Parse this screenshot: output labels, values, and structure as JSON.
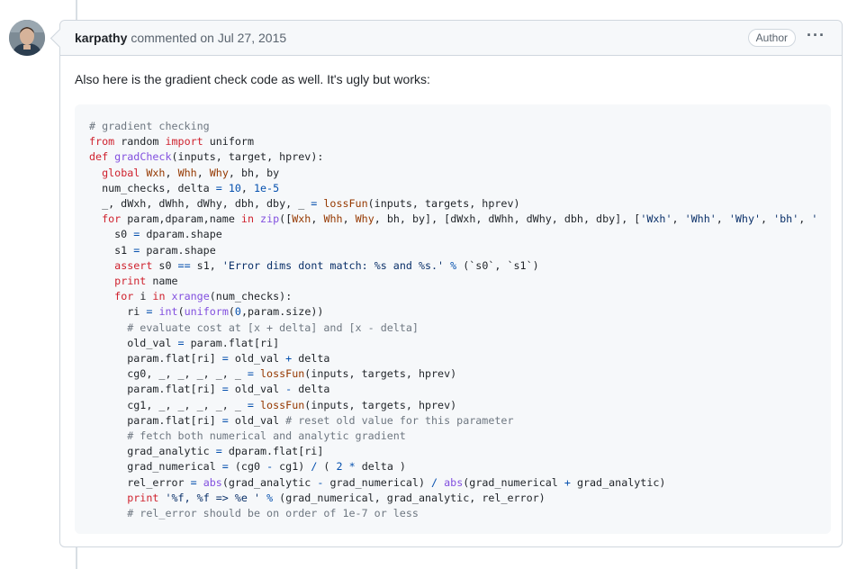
{
  "comment": {
    "author": "karpathy",
    "action": "commented on Jul 27, 2015",
    "badge": "Author",
    "menu_glyph": "···",
    "text": "Also here is the gradient check code as well. It's ugly but works:",
    "avatar_icon": "user-avatar"
  },
  "colors": {
    "keyword": "#cf222e",
    "function": "#8250df",
    "number": "#0550ae",
    "string": "#0a3069",
    "comment": "#6e7781",
    "variable": "#953800"
  },
  "code_lines": [
    [
      [
        "cm",
        "# gradient checking"
      ]
    ],
    [
      [
        "kw",
        "from"
      ],
      [
        "",
        " random "
      ],
      [
        "kw",
        "import"
      ],
      [
        "",
        " uniform"
      ]
    ],
    [
      [
        "kw",
        "def"
      ],
      [
        "",
        " "
      ],
      [
        "fn",
        "gradCheck"
      ],
      [
        "",
        "(inputs, target, hprev):"
      ]
    ],
    [
      [
        "",
        "  "
      ],
      [
        "kw",
        "global"
      ],
      [
        "",
        " "
      ],
      [
        "var",
        "Wxh"
      ],
      [
        "",
        ", "
      ],
      [
        "var",
        "Whh"
      ],
      [
        "",
        ", "
      ],
      [
        "var",
        "Why"
      ],
      [
        "",
        ", bh, by"
      ]
    ],
    [
      [
        "",
        "  num_checks, delta "
      ],
      [
        "op",
        "="
      ],
      [
        "",
        " "
      ],
      [
        "num",
        "10"
      ],
      [
        "",
        ", "
      ],
      [
        "num",
        "1e-5"
      ]
    ],
    [
      [
        "",
        "  _, dWxh, dWhh, dWhy, dbh, dby, _ "
      ],
      [
        "op",
        "="
      ],
      [
        "",
        " "
      ],
      [
        "var",
        "lossFun"
      ],
      [
        "",
        "(inputs, targets, hprev)"
      ]
    ],
    [
      [
        "",
        "  "
      ],
      [
        "kw",
        "for"
      ],
      [
        "",
        " param,dparam,name "
      ],
      [
        "kw",
        "in"
      ],
      [
        "",
        " "
      ],
      [
        "fn",
        "zip"
      ],
      [
        "",
        "(["
      ],
      [
        "var",
        "Wxh"
      ],
      [
        "",
        ", "
      ],
      [
        "var",
        "Whh"
      ],
      [
        "",
        ", "
      ],
      [
        "var",
        "Why"
      ],
      [
        "",
        ", bh, by], [dWxh, dWhh, dWhy, dbh, dby], ["
      ],
      [
        "str",
        "'Wxh'"
      ],
      [
        "",
        ", "
      ],
      [
        "str",
        "'Whh'"
      ],
      [
        "",
        ", "
      ],
      [
        "str",
        "'Why'"
      ],
      [
        "",
        ", "
      ],
      [
        "str",
        "'bh'"
      ],
      [
        "",
        ", "
      ],
      [
        "str",
        "'by'"
      ],
      [
        "",
        "]):"
      ]
    ],
    [
      [
        "",
        "    s0 "
      ],
      [
        "op",
        "="
      ],
      [
        "",
        " dparam.shape"
      ]
    ],
    [
      [
        "",
        "    s1 "
      ],
      [
        "op",
        "="
      ],
      [
        "",
        " param.shape"
      ]
    ],
    [
      [
        "",
        "    "
      ],
      [
        "kw",
        "assert"
      ],
      [
        "",
        " s0 "
      ],
      [
        "op",
        "=="
      ],
      [
        "",
        " s1, "
      ],
      [
        "str",
        "'Error dims dont match: %s and %s.'"
      ],
      [
        "",
        " "
      ],
      [
        "op",
        "%"
      ],
      [
        "",
        " (`s0`, `s1`)"
      ]
    ],
    [
      [
        "",
        "    "
      ],
      [
        "kw",
        "print"
      ],
      [
        "",
        " name"
      ]
    ],
    [
      [
        "",
        "    "
      ],
      [
        "kw",
        "for"
      ],
      [
        "",
        " i "
      ],
      [
        "kw",
        "in"
      ],
      [
        "",
        " "
      ],
      [
        "fn",
        "xrange"
      ],
      [
        "",
        "(num_checks):"
      ]
    ],
    [
      [
        "",
        "      ri "
      ],
      [
        "op",
        "="
      ],
      [
        "",
        " "
      ],
      [
        "fn",
        "int"
      ],
      [
        "",
        "("
      ],
      [
        "fn",
        "uniform"
      ],
      [
        "",
        "("
      ],
      [
        "num",
        "0"
      ],
      [
        "",
        ",param.size))"
      ]
    ],
    [
      [
        "",
        "      "
      ],
      [
        "cm",
        "# evaluate cost at [x + delta] and [x - delta]"
      ]
    ],
    [
      [
        "",
        "      old_val "
      ],
      [
        "op",
        "="
      ],
      [
        "",
        " param.flat[ri]"
      ]
    ],
    [
      [
        "",
        "      param.flat[ri] "
      ],
      [
        "op",
        "="
      ],
      [
        "",
        " old_val "
      ],
      [
        "op",
        "+"
      ],
      [
        "",
        " delta"
      ]
    ],
    [
      [
        "",
        "      cg0, _, _, _, _, _ "
      ],
      [
        "op",
        "="
      ],
      [
        "",
        " "
      ],
      [
        "var",
        "lossFun"
      ],
      [
        "",
        "(inputs, targets, hprev)"
      ]
    ],
    [
      [
        "",
        "      param.flat[ri] "
      ],
      [
        "op",
        "="
      ],
      [
        "",
        " old_val "
      ],
      [
        "op",
        "-"
      ],
      [
        "",
        " delta"
      ]
    ],
    [
      [
        "",
        "      cg1, _, _, _, _, _ "
      ],
      [
        "op",
        "="
      ],
      [
        "",
        " "
      ],
      [
        "var",
        "lossFun"
      ],
      [
        "",
        "(inputs, targets, hprev)"
      ]
    ],
    [
      [
        "",
        "      param.flat[ri] "
      ],
      [
        "op",
        "="
      ],
      [
        "",
        " old_val "
      ],
      [
        "cm",
        "# reset old value for this parameter"
      ]
    ],
    [
      [
        "",
        "      "
      ],
      [
        "cm",
        "# fetch both numerical and analytic gradient"
      ]
    ],
    [
      [
        "",
        "      grad_analytic "
      ],
      [
        "op",
        "="
      ],
      [
        "",
        " dparam.flat[ri]"
      ]
    ],
    [
      [
        "",
        "      grad_numerical "
      ],
      [
        "op",
        "="
      ],
      [
        "",
        " (cg0 "
      ],
      [
        "op",
        "-"
      ],
      [
        "",
        " cg1) "
      ],
      [
        "op",
        "/"
      ],
      [
        "",
        " ( "
      ],
      [
        "num",
        "2"
      ],
      [
        "",
        " "
      ],
      [
        "op",
        "*"
      ],
      [
        "",
        " delta )"
      ]
    ],
    [
      [
        "",
        "      rel_error "
      ],
      [
        "op",
        "="
      ],
      [
        "",
        " "
      ],
      [
        "fn",
        "abs"
      ],
      [
        "",
        "(grad_analytic "
      ],
      [
        "op",
        "-"
      ],
      [
        "",
        " grad_numerical) "
      ],
      [
        "op",
        "/"
      ],
      [
        "",
        " "
      ],
      [
        "fn",
        "abs"
      ],
      [
        "",
        "(grad_numerical "
      ],
      [
        "op",
        "+"
      ],
      [
        "",
        " grad_analytic)"
      ]
    ],
    [
      [
        "",
        "      "
      ],
      [
        "kw",
        "print"
      ],
      [
        "",
        " "
      ],
      [
        "str",
        "'%f, %f => %e '"
      ],
      [
        "",
        " "
      ],
      [
        "op",
        "%"
      ],
      [
        "",
        " (grad_numerical, grad_analytic, rel_error)"
      ]
    ],
    [
      [
        "",
        "      "
      ],
      [
        "cm",
        "# rel_error should be on order of 1e-7 or less"
      ]
    ]
  ]
}
